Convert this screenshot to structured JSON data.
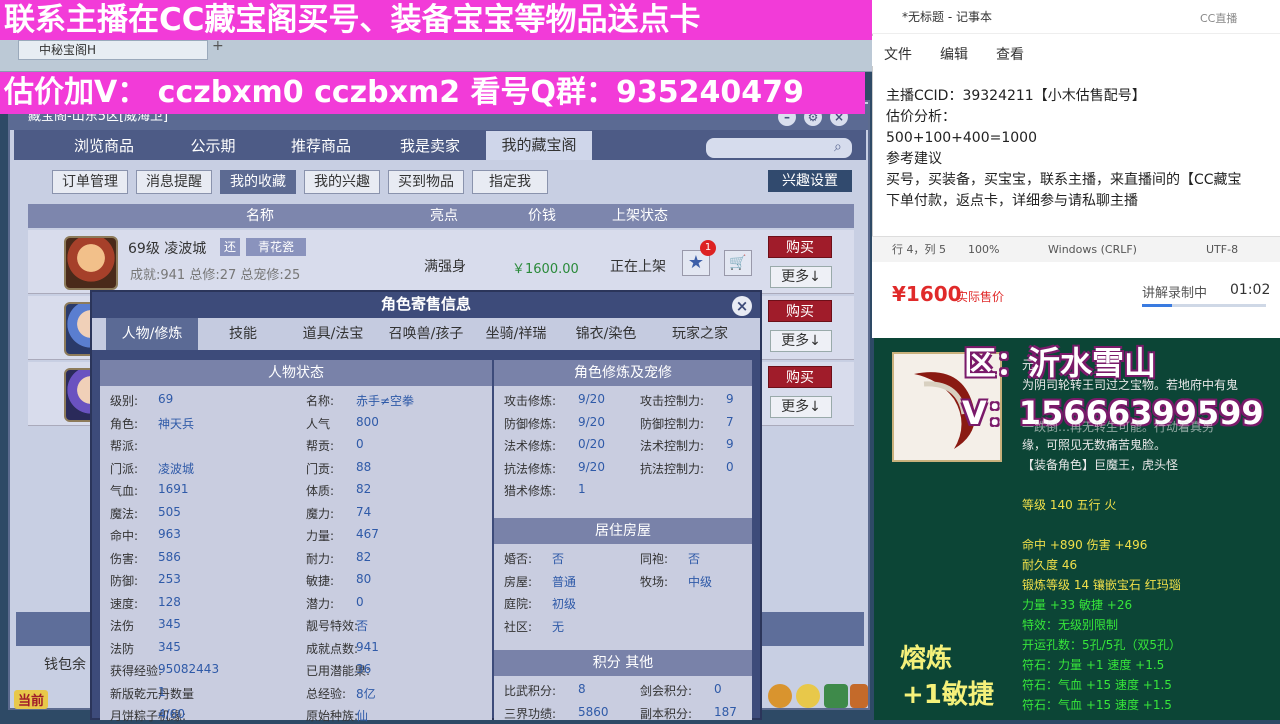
{
  "banner_top": "联系主播在CC藏宝阁买号、装备宝宝等物品送点卡",
  "banner_second": "估价加V：  cczbxm0   cczbxm2   看号Q群：935240479",
  "browser_tab": "中秘宝阁H",
  "game_window": {
    "title": "藏宝阁-山东5区[威海卫]",
    "nav_tabs": [
      "浏览商品",
      "公示期",
      "推荐商品",
      "我是卖家",
      "我的藏宝阁"
    ],
    "sub_buttons": [
      "订单管理",
      "消息提醒",
      "我的收藏",
      "我的兴趣",
      "买到物品",
      "指定我"
    ],
    "interest_setting": "兴趣设置",
    "table_headers": {
      "name": "名称",
      "highlight": "亮点",
      "price": "价钱",
      "status": "上架状态"
    },
    "row1": {
      "level_school": "69级  凌波城",
      "tag1": "还",
      "tag2": "青花瓷",
      "stats": "成就:941 总修:27 总宠修:25",
      "highlight": "满强身",
      "price": "￥1600.00",
      "status": "正在上架",
      "badge": "1"
    },
    "buy_label": "购买",
    "more_label": "更多↓",
    "wallet_label": "钱包余",
    "current_label": "当前"
  },
  "modal": {
    "title": "角色寄售信息",
    "tabs": [
      "人物/修炼",
      "技能",
      "道具/法宝",
      "召唤兽/孩子",
      "坐骑/祥瑞",
      "锦衣/染色",
      "玩家之家"
    ],
    "left_header": "人物状态",
    "left_col1": [
      {
        "k": "级别:",
        "v": "69"
      },
      {
        "k": "角色:",
        "v": "神天兵"
      },
      {
        "k": "帮派:",
        "v": ""
      },
      {
        "k": "门派:",
        "v": "凌波城"
      },
      {
        "k": "气血:",
        "v": "1691"
      },
      {
        "k": "魔法:",
        "v": "505"
      },
      {
        "k": "命中:",
        "v": "963"
      },
      {
        "k": "伤害:",
        "v": "586"
      },
      {
        "k": "防御:",
        "v": "253"
      },
      {
        "k": "速度:",
        "v": "128"
      },
      {
        "k": "法伤",
        "v": "345"
      },
      {
        "k": "法防",
        "v": "345"
      },
      {
        "k": "获得经验:",
        "v": "95082443"
      },
      {
        "k": "新版乾元丹数量",
        "v": "1"
      },
      {
        "k": "月饼粽子机缘:",
        "v": "4/60"
      }
    ],
    "left_col2": [
      {
        "k": "名称:",
        "v": "赤手≠空拳"
      },
      {
        "k": "人气",
        "v": "800"
      },
      {
        "k": "帮贡:",
        "v": "0"
      },
      {
        "k": "门贡:",
        "v": "88"
      },
      {
        "k": "体质:",
        "v": "82"
      },
      {
        "k": "魔力:",
        "v": "74"
      },
      {
        "k": "力量:",
        "v": "467"
      },
      {
        "k": "耐力:",
        "v": "82"
      },
      {
        "k": "敏捷:",
        "v": "80"
      },
      {
        "k": "潜力:",
        "v": "0"
      },
      {
        "k": "靓号特效:",
        "v": "否"
      },
      {
        "k": "成就点数:",
        "v": "941"
      },
      {
        "k": "已用潜能果:",
        "v": "36"
      },
      {
        "k": "总经验:",
        "v": "8亿"
      },
      {
        "k": "原始种族:",
        "v": "仙"
      }
    ],
    "right_header1": "角色修炼及宠修",
    "right_col1": [
      {
        "k": "攻击修炼:",
        "v": "9/20"
      },
      {
        "k": "防御修炼:",
        "v": "9/20"
      },
      {
        "k": "法术修炼:",
        "v": "0/20"
      },
      {
        "k": "抗法修炼:",
        "v": "9/20"
      },
      {
        "k": "猎术修炼:",
        "v": "1"
      }
    ],
    "right_col2": [
      {
        "k": "攻击控制力:",
        "v": "9"
      },
      {
        "k": "防御控制力:",
        "v": "7"
      },
      {
        "k": "法术控制力:",
        "v": "9"
      },
      {
        "k": "抗法控制力:",
        "v": "0"
      }
    ],
    "right_header2": "居住房屋",
    "house_col1": [
      {
        "k": "婚否:",
        "v": "否"
      },
      {
        "k": "房屋:",
        "v": "普通"
      },
      {
        "k": "庭院:",
        "v": "初级"
      },
      {
        "k": "社区:",
        "v": "无"
      }
    ],
    "house_col2": [
      {
        "k": "同袍:",
        "v": "否"
      },
      {
        "k": "牧场:",
        "v": "中级"
      }
    ],
    "right_header3": "积分 其他",
    "score_col1": [
      {
        "k": "比武积分:",
        "v": "8"
      },
      {
        "k": "三界功绩:",
        "v": "5860"
      }
    ],
    "score_col2": [
      {
        "k": "剑会积分:",
        "v": "0"
      },
      {
        "k": "副本积分:",
        "v": "187"
      }
    ]
  },
  "notepad": {
    "title": "*无标题 - 记事本",
    "menu": [
      "文件",
      "编辑",
      "查看"
    ],
    "lines": [
      "主播CCID：39324211【小木估售配号】",
      "估价分析：",
      "500+100+400=1000",
      "参考建议",
      "买号，买装备，买宝宝，联系主播，来直播间的【CC藏宝",
      "下单付款，返点卡，详细参与请私聊主播"
    ],
    "status_pos": "行 4，列 5",
    "status_zoom": "100%",
    "status_eol": "Windows (CRLF)",
    "status_enc": "UTF-8"
  },
  "price_panel": {
    "price": "¥1600",
    "price_note": "实际售价",
    "record_label": "讲解录制中",
    "record_time": "01:02"
  },
  "live_panel": {
    "area_overlay": "区：沂水雪山",
    "v_overlay": "V：15666399599",
    "desc1": "元",
    "desc2": "为阴司轮转王司过之宝物。若地府中有鬼",
    "desc3": "一跌倒…再无转生可能。行动着真另",
    "desc4": "缘，可照见无数痛苦鬼脸。",
    "role": "【装备角色】巨魔王，虎头怪",
    "level_element": "等级 140 五行 火",
    "hit_dmg": "命中 +890 伤害 +496",
    "durability": "耐久度 46",
    "forge": "锻炼等级 14 镶嵌宝石 红玛瑙",
    "str_agi": "力量 +33 敏捷 +26",
    "special": "特效：无级别限制",
    "holes": "开运孔数：5孔/5孔（双5孔）",
    "rune1": "符石：力量 +1 速度 +1.5",
    "rune2": "符石：气血 +15 速度 +1.5",
    "rune3": "符石：气血 +15 速度 +1.5",
    "melt_label": "熔炼",
    "melt_value": "+1敏捷"
  },
  "cc_watermark": "CC直播"
}
